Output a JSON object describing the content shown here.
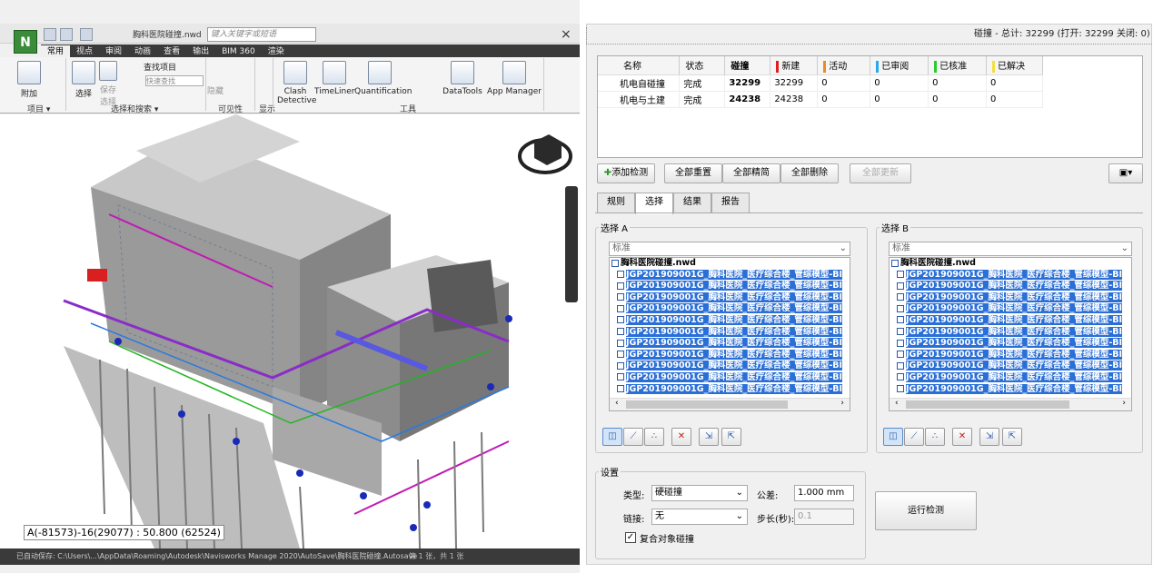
{
  "app": {
    "logo": "N",
    "title": "胸科医院碰撞.nwd",
    "search_placeholder": "键入关键字或短语",
    "close": "×",
    "tabs": [
      "常用",
      "视点",
      "审阅",
      "动画",
      "查看",
      "输出",
      "BIM 360",
      "渲染"
    ],
    "ribbon": {
      "append": "附加",
      "select": "选择",
      "save_select": "保存\n选择",
      "find_items": "查找项目",
      "quick_find": "快速查找",
      "hide": "隐藏",
      "clash": "Clash\nDetective",
      "timeliner": "TimeLiner",
      "quant": "Quantification",
      "datatools": "DataTools",
      "appmgr": "App Manager",
      "groups": [
        "项目 ▾",
        "选择和搜索 ▾",
        "可见性",
        "显示",
        "工具"
      ]
    },
    "coord": "A(-81573)-16(29077) : 50.800 (62524)",
    "status": "已自动保存: C:\\Users\\...\\AppData\\Roaming\\Autodesk\\Navisworks Manage 2020\\AutoSave\\胸科医院碰撞.Autosave",
    "page": "第 1 张，共 1 张"
  },
  "panel": {
    "summary": "碰撞 - 总计: 32299 (打开: 32299 关闭: 0)",
    "columns": [
      "名称",
      "状态",
      "碰撞",
      "新建",
      "活动",
      "已审阅",
      "已核准",
      "已解决"
    ],
    "col_colors": [
      "#e02020",
      "#f08a1c",
      "#2aa8e8",
      "#2ccc2c",
      "#f0e040"
    ],
    "rows": [
      [
        "机电自碰撞",
        "完成",
        "32299",
        "32299",
        "0",
        "0",
        "0",
        "0"
      ],
      [
        "机电与土建",
        "完成",
        "24238",
        "24238",
        "0",
        "0",
        "0",
        "0"
      ]
    ],
    "buttons": {
      "add": "添加检测",
      "reset": "全部重置",
      "compact": "全部精简",
      "delete": "全部删除",
      "update": "全部更新"
    },
    "tabs": [
      "规则",
      "选择",
      "结果",
      "报告"
    ],
    "selA": {
      "legend": "选择 A",
      "mode": "标准",
      "root": "胸科医院碰撞.nwd",
      "item": "JGP201909001G_胸科医院_医疗综合楼_管综模型-BI"
    },
    "selB": {
      "legend": "选择 B",
      "mode": "标准",
      "root": "胸科医院碰撞.nwd",
      "item": "JGP201909001G_胸科医院_医疗综合楼_管综模型-BI"
    },
    "settings": {
      "legend": "设置",
      "type_label": "类型:",
      "type": "硬碰撞",
      "tol_label": "公差:",
      "tol": "1.000 mm",
      "link_label": "链接:",
      "link": "无",
      "step_label": "步长(秒):",
      "step": "0.1",
      "composite": "复合对象碰撞",
      "run": "运行检测"
    }
  }
}
